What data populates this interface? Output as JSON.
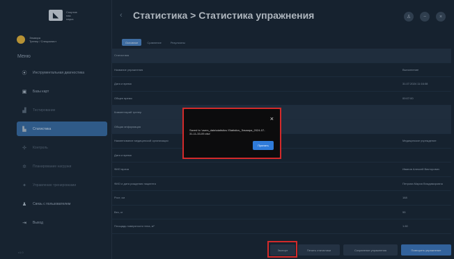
{
  "brand": {
    "lines": [
      "Спортив",
      "ная",
      "наука"
    ]
  },
  "user": {
    "name": "Эльвира",
    "role": "Тренер / Специалист"
  },
  "sidebar": {
    "menu_title": "Меню",
    "items": [
      {
        "label": "Инструментальная диагностика",
        "icon": "activity-icon",
        "state": "normal"
      },
      {
        "label": "Базы карт",
        "icon": "card-icon",
        "state": "normal"
      },
      {
        "label": "Тестирование",
        "icon": "chart-icon",
        "state": "dim"
      },
      {
        "label": "Статистика",
        "icon": "stats-icon",
        "state": "active"
      },
      {
        "label": "Контроль",
        "icon": "control-icon",
        "state": "dim"
      },
      {
        "label": "Планирование нагрузки",
        "icon": "plan-icon",
        "state": "dim"
      },
      {
        "label": "Управление тренировками",
        "icon": "manage-icon",
        "state": "dim"
      },
      {
        "label": "Связь с пользователем",
        "icon": "user-icon",
        "state": "normal"
      },
      {
        "label": "Выход",
        "icon": "exit-icon",
        "state": "normal"
      }
    ],
    "version": "v1.0"
  },
  "header": {
    "back": "‹",
    "title": "Статистика > Статистика упражнения"
  },
  "tabs": [
    {
      "label": "Основное",
      "active": true
    },
    {
      "label": "Сравнение",
      "active": false
    },
    {
      "label": "Результаты",
      "active": false
    }
  ],
  "table": {
    "rows": [
      {
        "label": "Статистика",
        "value": "",
        "section": true
      },
      {
        "label": "Название упражнения",
        "value": "Выполнение"
      },
      {
        "label": "Дата и время",
        "value": "31.07.2024 11:16:08"
      },
      {
        "label": "Общее время",
        "value": "00:07:00"
      },
      {
        "label": "Комментарий тренер",
        "value": "",
        "section": true
      },
      {
        "label": "Общая информация",
        "value": ""
      },
      {
        "label": "Наименование медицинской организации",
        "value": "Медицинское учреждение"
      },
      {
        "label": "Дата и время",
        "value": ""
      },
      {
        "label": "ФИО врача",
        "value": "Иванов Алексей Викторович"
      },
      {
        "label": "ФИО и дата рождения пациента",
        "value": "Петрова Мария Владимировна"
      },
      {
        "label": "Рост, см",
        "value": "168"
      },
      {
        "label": "Вес, кг",
        "value": "55"
      },
      {
        "label": "Площадь поверхности тела, м²",
        "value": "1.60"
      }
    ]
  },
  "modal": {
    "close": "×",
    "message": "Saved to 'users_data\\statistics \\Statistics_Эльвира_2024-07-31-11-33-09.xlsx'",
    "ok_label": "Принять"
  },
  "footer": {
    "export_label": "Экспорт",
    "buttons": [
      "Печать статистики",
      "Сохранение упражнения",
      "Повторить упражнение"
    ]
  }
}
